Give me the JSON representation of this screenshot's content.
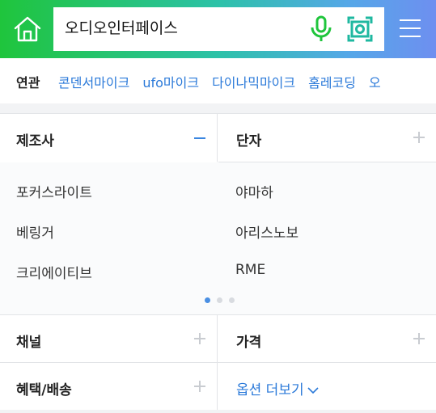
{
  "search": {
    "query": "오디오인터페이스"
  },
  "icons": {
    "home": "home-icon",
    "mic": "microphone-icon",
    "lens": "lens-camera-icon",
    "menu": "hamburger-menu-icon"
  },
  "colors": {
    "accent": "#2a79d9",
    "mic_green": "#1fc53c"
  },
  "related": {
    "label": "연관",
    "items": [
      "콘덴서마이크",
      "ufo마이크",
      "다이나믹마이크",
      "홈레코딩",
      "오"
    ]
  },
  "filters": {
    "manufacturer": {
      "title": "제조사",
      "options": [
        "포커스라이트",
        "베링거",
        "크리에이티브",
        "야마하",
        "아리스노보",
        "RME"
      ]
    },
    "terminal": {
      "title": "단자"
    },
    "channel": {
      "title": "채널"
    },
    "price": {
      "title": "가격"
    },
    "benefit": {
      "title": "혜택/배송"
    },
    "more_options": "옵션 더보기"
  },
  "pagination": {
    "pages": 3,
    "current": 1
  }
}
